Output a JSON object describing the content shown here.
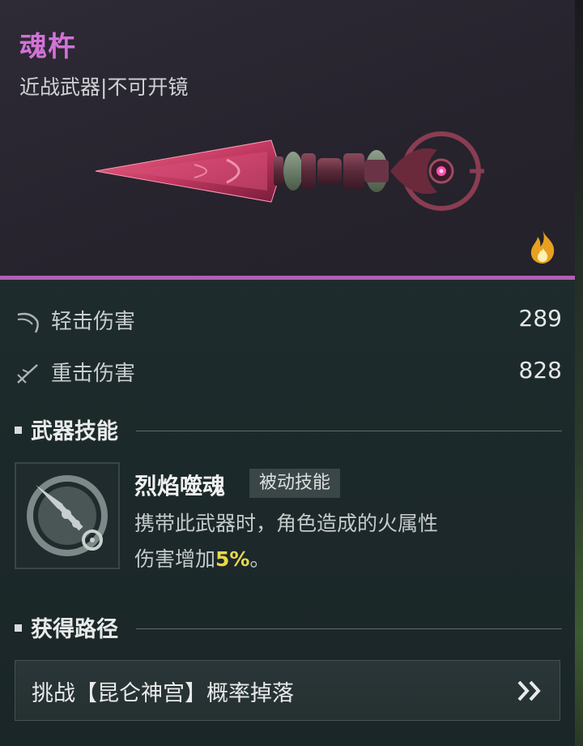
{
  "item": {
    "name": "魂杵",
    "subtitle": "近战武器|不可开镜",
    "element_icon": "fire-icon"
  },
  "stats": [
    {
      "icon": "light-attack-icon",
      "label": "轻击伤害",
      "value": "289"
    },
    {
      "icon": "heavy-attack-icon",
      "label": "重击伤害",
      "value": "828"
    }
  ],
  "skill_section": {
    "title": "武器技能",
    "skill_name": "烈焰噬魂",
    "skill_tag": "被动技能",
    "desc_line1": "携带此武器时，角色造成的火属性",
    "desc_line2_prefix": "伤害增加",
    "desc_highlight": "5%",
    "desc_line2_suffix": "。"
  },
  "source_section": {
    "title": "获得路径",
    "source_text": "挑战【昆仑神宫】概率掉落"
  },
  "colors": {
    "rarity": "#d272d6",
    "highlight": "#e9d74a",
    "fire": "#e8a020"
  }
}
